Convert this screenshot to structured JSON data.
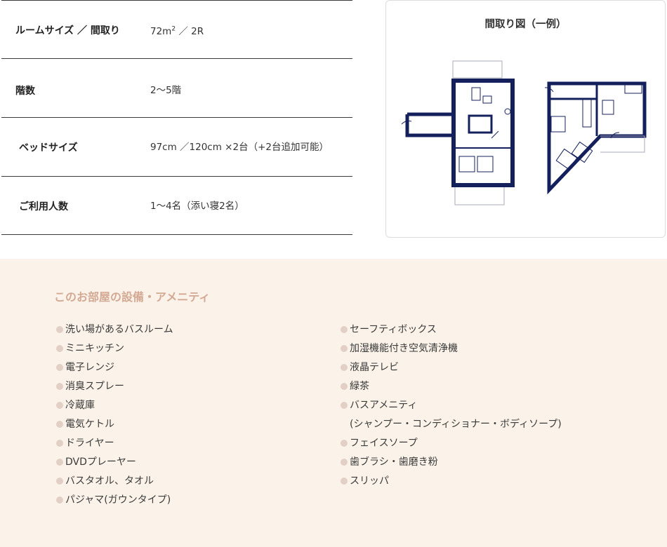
{
  "specs": [
    {
      "label": "ルームサイズ ／ 間取り",
      "value_main": "72m",
      "value_sup": "2",
      "value_rest": " ／ 2R"
    },
    {
      "label": "階数",
      "value": "2〜5階"
    },
    {
      "label": "ベッドサイズ",
      "value": "97cm ／120cm ×2台（+2台追加可能）"
    },
    {
      "label": "ご利用人数",
      "value": "1〜4名（添い寝2名）"
    }
  ],
  "floor_plan": {
    "title": "間取り図（一例）"
  },
  "amenities": {
    "title": "このお部屋の設備・アメニティ",
    "left": [
      "洗い場があるバスルーム",
      "ミニキッチン",
      "電子レンジ",
      "消臭スプレー",
      "冷蔵庫",
      "電気ケトル",
      "ドライヤー",
      "DVDプレーヤー",
      "バスタオル、タオル",
      "パジャマ(ガウンタイプ)"
    ],
    "right": [
      "セーフティボックス",
      "加湿機能付き空気清浄機",
      "液晶テレビ",
      "緑茶",
      "バスアメニティ",
      "(シャンプー・コンディショナー・ボディソープ)",
      "フェイスソープ",
      "歯ブラシ・歯磨き粉",
      "スリッパ"
    ]
  },
  "colors": {
    "plan_wall": "#14205c",
    "amenity_bg": "#fbf3e9",
    "amenity_title": "#d3a994",
    "bullet": "#e2cfc5"
  }
}
